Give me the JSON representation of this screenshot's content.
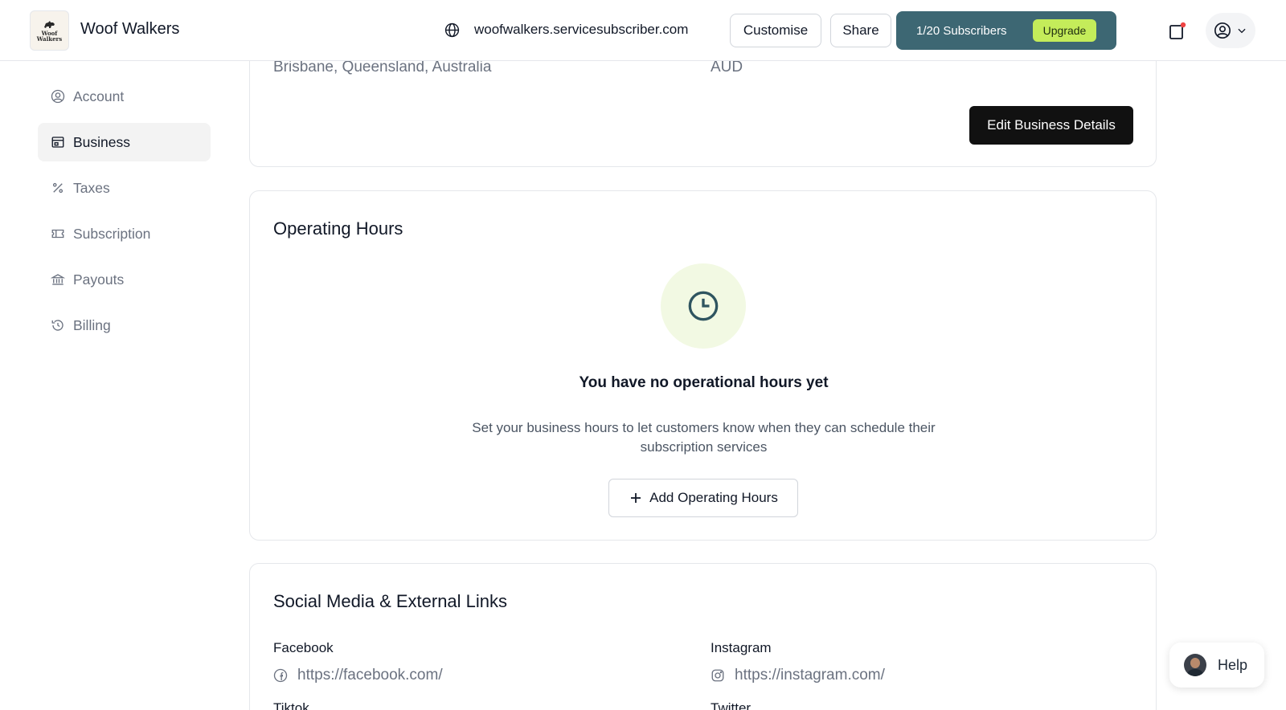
{
  "header": {
    "brand_name": "Woof Walkers",
    "logo_text_line1": "Woof",
    "logo_text_line2": "Walkers",
    "site_url": "woofwalkers.servicesubscriber.com",
    "customise_label": "Customise",
    "share_label": "Share",
    "subscribers_text": "1/20 Subscribers",
    "upgrade_label": "Upgrade",
    "accent_color": "#3d6773",
    "upgrade_color": "#c4ec5a"
  },
  "sidebar": {
    "items": [
      {
        "label": "Account",
        "icon": "user-circle-icon",
        "active": false
      },
      {
        "label": "Business",
        "icon": "store-icon",
        "active": true
      },
      {
        "label": "Taxes",
        "icon": "percent-icon",
        "active": false
      },
      {
        "label": "Subscription",
        "icon": "ticket-icon",
        "active": false
      },
      {
        "label": "Payouts",
        "icon": "bank-icon",
        "active": false
      },
      {
        "label": "Billing",
        "icon": "history-icon",
        "active": false
      }
    ]
  },
  "business_card": {
    "location": "Brisbane, Queensland, Australia",
    "currency": "AUD",
    "edit_label": "Edit Business Details"
  },
  "operating_hours": {
    "title": "Operating Hours",
    "empty_title": "You have no operational hours yet",
    "empty_desc": "Set your business hours to let customers know when they can schedule their subscription services",
    "add_label": "Add Operating Hours"
  },
  "social": {
    "title": "Social Media & External Links",
    "facebook_label": "Facebook",
    "facebook_value": "https://facebook.com/",
    "instagram_label": "Instagram",
    "instagram_value": "https://instagram.com/",
    "tiktok_label": "Tiktok",
    "twitter_label": "Twitter"
  },
  "help": {
    "label": "Help"
  }
}
